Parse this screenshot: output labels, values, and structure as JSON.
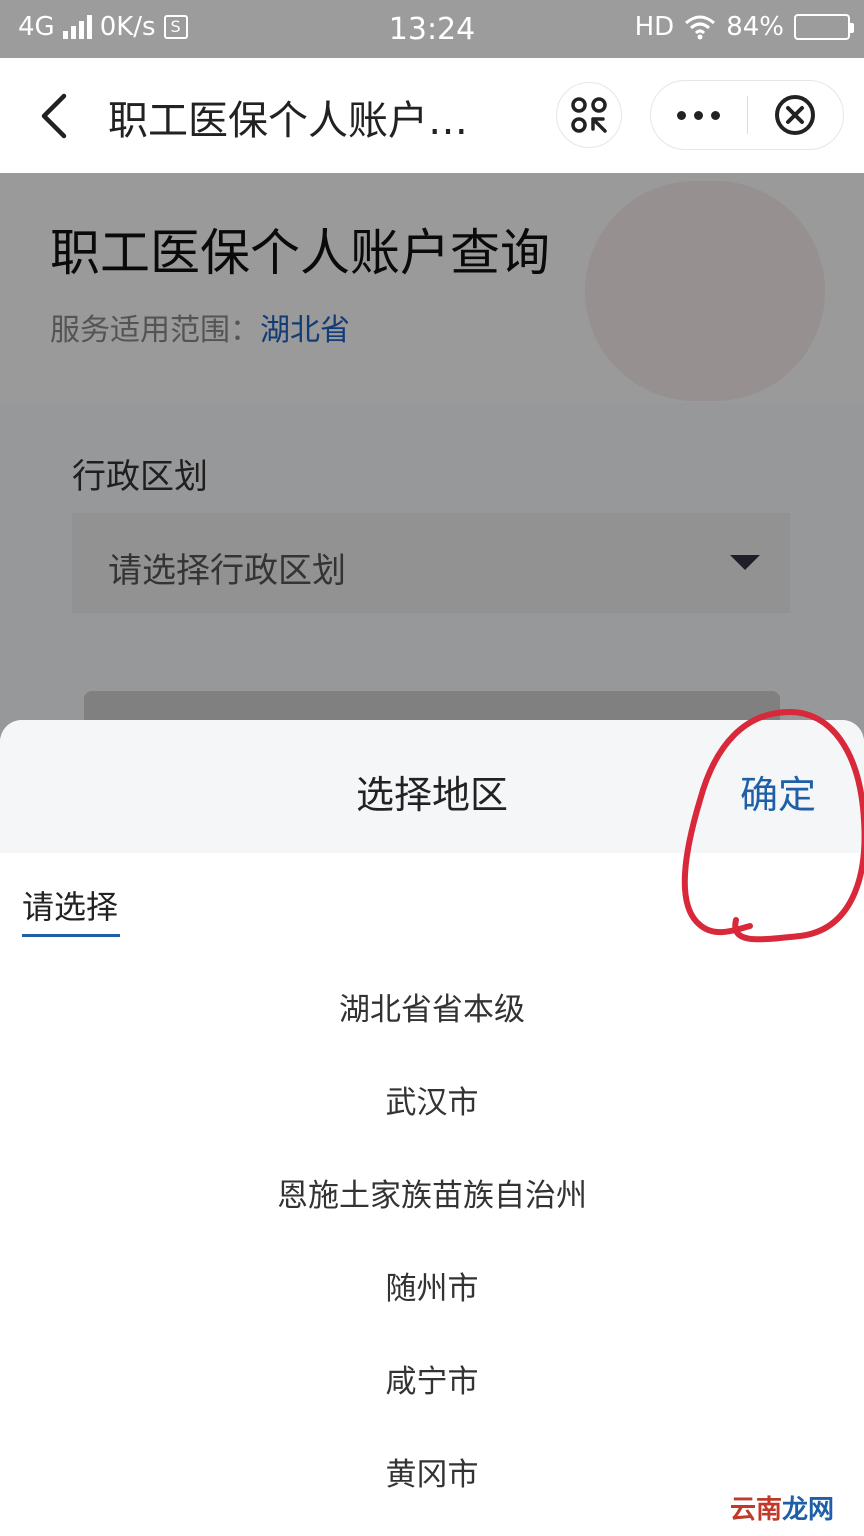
{
  "status_bar": {
    "network": "4G",
    "speed": "0K/s",
    "time": "13:24",
    "hd": "HD",
    "battery": "84%",
    "battery_level": 0.84
  },
  "nav": {
    "title": "职工医保个人账户…"
  },
  "page": {
    "title": "职工医保个人账户查询",
    "scope_label": "服务适用范围：",
    "scope_value": "湖北省",
    "field_label": "行政区划",
    "select_placeholder": "请选择行政区划"
  },
  "sheet": {
    "title": "选择地区",
    "confirm": "确定",
    "tab_label": "请选择",
    "options": [
      "湖北省省本级",
      "武汉市",
      "恩施土家族苗族自治州",
      "随州市",
      "咸宁市",
      "黄冈市"
    ]
  },
  "watermark": {
    "part1": "云南",
    "part2": "龙网"
  },
  "colors": {
    "accent": "#1e5fa8",
    "annotation": "#d8283a"
  }
}
